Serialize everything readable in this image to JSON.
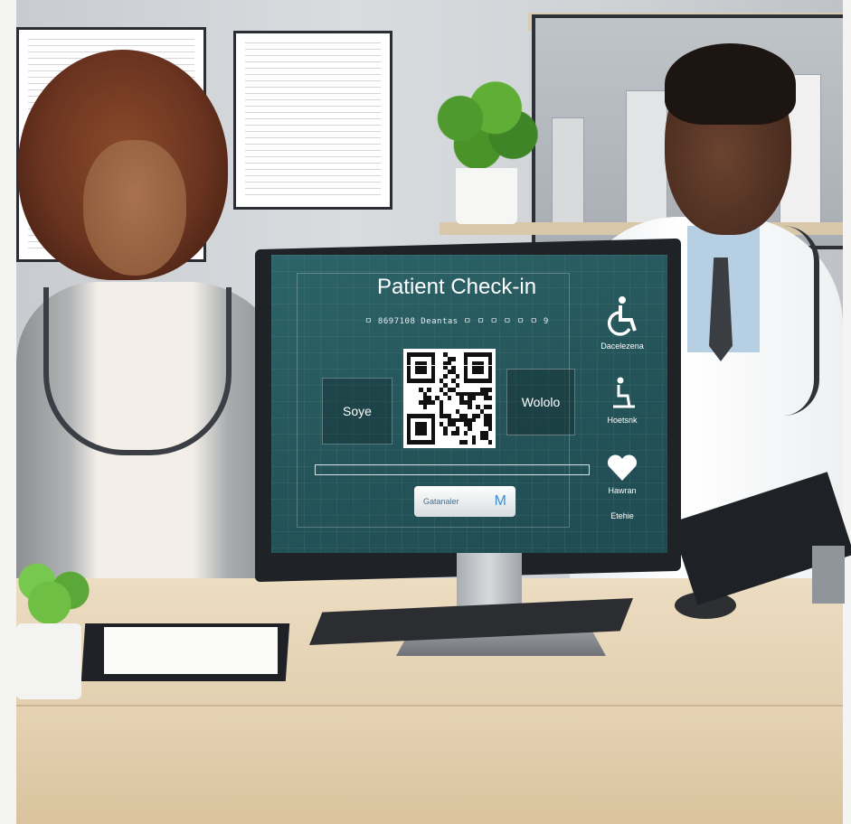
{
  "screen": {
    "title": "Patient Check-in",
    "subtitle": "ㅁ 8697108 Deantas ㅁ ㅁ ㅁ ㅁ ㅁ ㅁ 9",
    "left_button": "Soye",
    "right_button": "Wololo",
    "progress": 0.0,
    "cta_label": "Gatanaler",
    "cta_glyph": "M",
    "side_items": [
      {
        "label": "Dacelezena",
        "icon": "wheelchair-icon"
      },
      {
        "label": "Hoetsnk",
        "icon": "accessibility-icon"
      },
      {
        "label": "Hawran",
        "icon": "heart-icon"
      },
      {
        "label": "Etehie",
        "icon": ""
      }
    ],
    "colors": {
      "screen_bg": "#245459",
      "accent": "#3e8fd6"
    }
  }
}
